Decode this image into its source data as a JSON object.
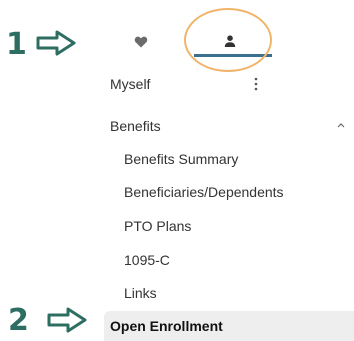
{
  "callouts": {
    "first": "1",
    "second": "2"
  },
  "tabs": {
    "favorites_icon": "heart-icon",
    "profile_icon": "person-icon",
    "active_tab": "profile"
  },
  "menu": {
    "myself": "Myself",
    "benefits": {
      "label": "Benefits",
      "expanded": true,
      "items": [
        "Benefits Summary",
        "Beneficiaries/Dependents",
        "PTO Plans",
        "1095-C",
        "Links"
      ]
    },
    "open_enrollment": "Open Enrollment"
  },
  "colors": {
    "callout": "#2e6e62",
    "active_underline": "#3c6e8e",
    "highlight_circle": "#f0b56a",
    "selected_row_bg": "#eeeeee"
  }
}
